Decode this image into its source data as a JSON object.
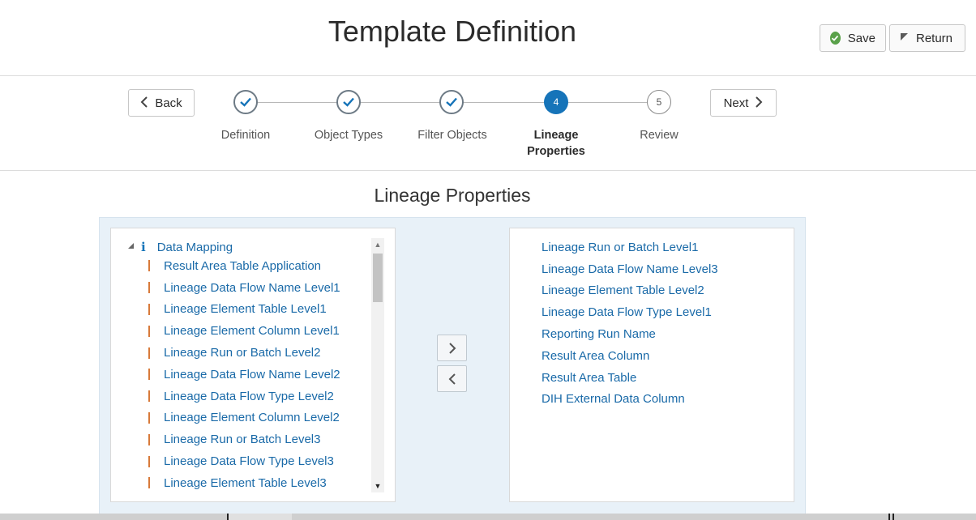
{
  "header": {
    "title": "Template Definition",
    "save_label": "Save",
    "return_label": "Return"
  },
  "train": {
    "back_label": "Back",
    "next_label": "Next",
    "current_step": 4,
    "stops": [
      {
        "label": "Definition",
        "state": "completed"
      },
      {
        "label": "Object Types",
        "state": "completed"
      },
      {
        "label": "Filter Objects",
        "state": "completed"
      },
      {
        "label": "Lineage",
        "label2": "Properties",
        "number": "4",
        "state": "current"
      },
      {
        "label": "Review",
        "number": "5",
        "state": "pending"
      }
    ]
  },
  "section_title": "Lineage Properties",
  "available": {
    "parent_label": "Data Mapping",
    "items": [
      "Result Area Table Application",
      "Lineage Data Flow Name Level1",
      "Lineage Element Table Level1",
      "Lineage Element Column Level1",
      "Lineage Run or Batch Level2",
      "Lineage Data Flow Name Level2",
      "Lineage Data Flow Type Level2",
      "Lineage Element Column Level2",
      "Lineage Run or Batch Level3",
      "Lineage Data Flow Type Level3",
      "Lineage Element Table Level3"
    ]
  },
  "selected": {
    "items": [
      "Lineage Run or Batch Level1",
      "Lineage Data Flow Name Level3",
      "Lineage Element Table Level2",
      "Lineage Data Flow Type Level1",
      "Reporting Run Name",
      "Result Area Column",
      "Result Area Table",
      "DIH External Data Column"
    ]
  },
  "icons": {
    "save": "check-circle-icon",
    "return": "flag-icon",
    "back": "chevron-left-icon",
    "next": "chevron-right-icon",
    "step_done": "checkmark-icon",
    "tree_toggle": "triangle-expanded-icon",
    "tree_parent": "info-icon",
    "move_right": "chevron-right-icon",
    "move_left": "chevron-left-icon"
  },
  "colors": {
    "accent": "#1674b9",
    "link": "#1a6aa8",
    "success": "#5aa14a",
    "leaf_marker": "#d87a3a",
    "shuttle_bg": "#e8f1f8"
  }
}
